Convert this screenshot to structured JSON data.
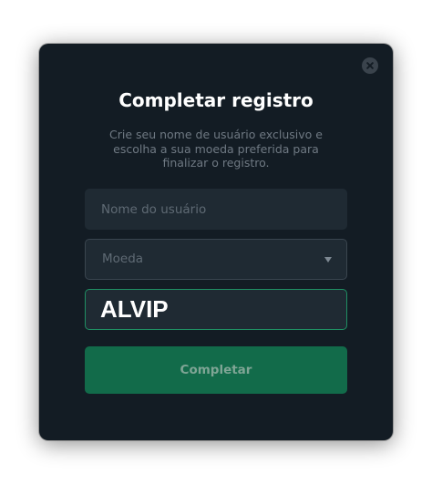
{
  "modal": {
    "title": "Completar registro",
    "description": "Crie seu nome de usuário exclusivo e escolha a sua moeda preferida para finalizar o registro.",
    "close_icon": "close-icon",
    "username": {
      "placeholder": "Nome do usuário",
      "value": ""
    },
    "currency": {
      "placeholder": "Moeda",
      "icon": "chevron-down-icon"
    },
    "code": {
      "value": "ALVIP"
    },
    "submit_label": "Completar"
  },
  "colors": {
    "modal_background": "#131c24",
    "field_background": "#1f2a33",
    "accent_border": "#1f8f63",
    "button_background": "#126b4a",
    "button_text": "#7fa595"
  }
}
